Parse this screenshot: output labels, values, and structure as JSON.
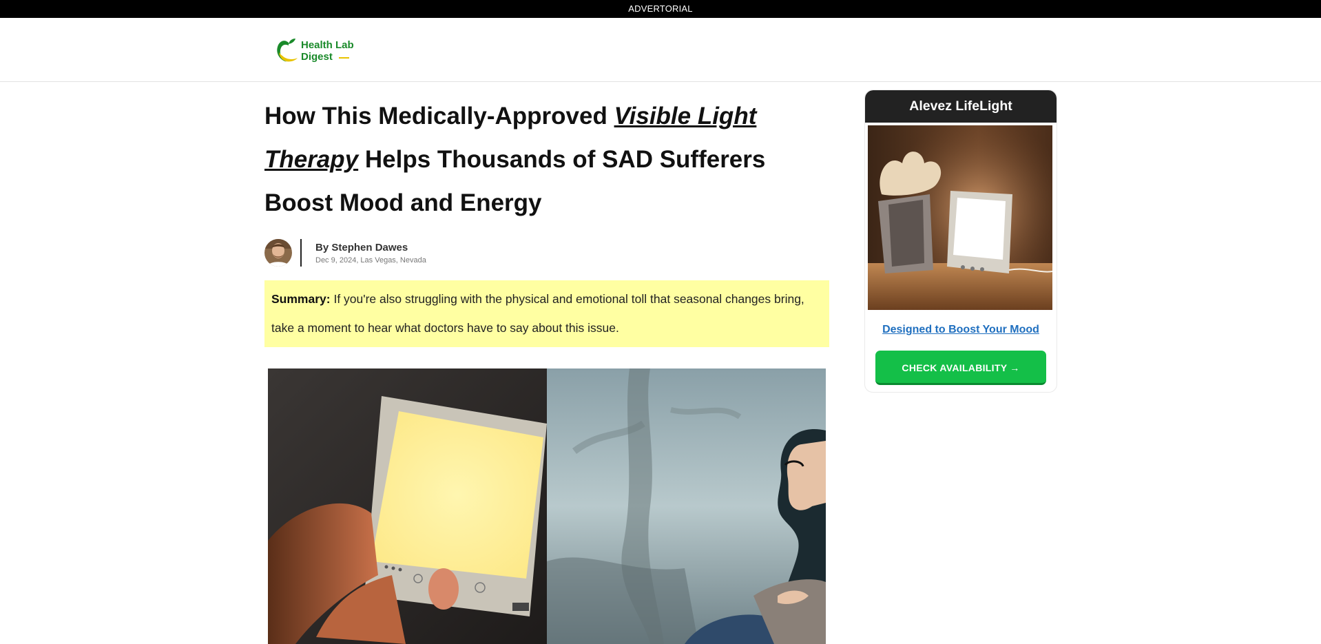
{
  "topbar": {
    "label": "ADVERTORIAL"
  },
  "brand": {
    "line1": "Health Lab",
    "line2": "Digest",
    "accent_green": "#1a8a2a",
    "accent_yellow": "#e8c300"
  },
  "article": {
    "headline_part1": "How This Medically-Approved ",
    "headline_emph1": "Visible Light",
    "headline_emph2": "Therapy",
    "headline_part2": " Helps Thousands of SAD Sufferers",
    "headline_part3": "Boost Mood and Energy",
    "author_prefix": "By",
    "author_name": "Stephen Dawes",
    "dateline": "Dec 9, 2024, Las Vegas, Nevada",
    "summary_label": "Summary:",
    "summary_text": " If you're also struggling with the physical and emotional toll that seasonal changes bring, take a moment to hear what doctors have to say about this issue."
  },
  "sidebar": {
    "title": "Alevez LifeLight",
    "link": "Designed to Boost Your Mood",
    "button": "CHECK AVAILABILITY →",
    "button_color": "#14bf48"
  }
}
